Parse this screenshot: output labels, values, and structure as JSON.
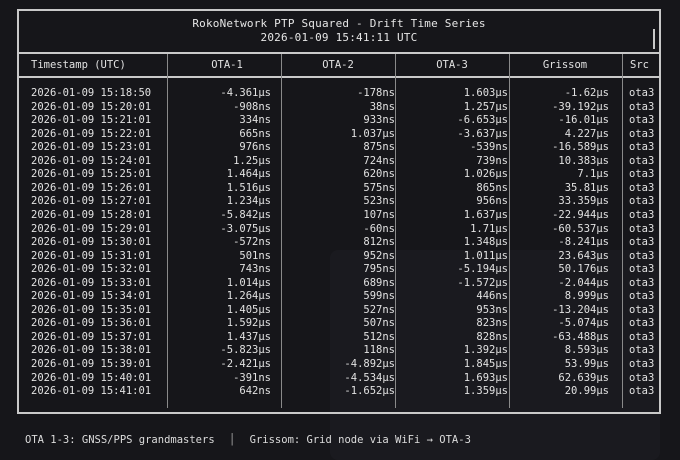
{
  "header": {
    "title": "RokoNetwork PTP Squared - Drift Time Series",
    "timestamp": "2026-01-09 15:41:11 UTC"
  },
  "columns": [
    "Timestamp (UTC)",
    "OTA-1",
    "OTA-2",
    "OTA-3",
    "Grissom",
    "Src"
  ],
  "rows": [
    [
      "2026-01-09 15:18:50",
      "-4.361µs",
      "-178ns",
      "1.603µs",
      "-1.62µs",
      "ota3"
    ],
    [
      "2026-01-09 15:20:01",
      "-908ns",
      "38ns",
      "1.257µs",
      "-39.192µs",
      "ota3"
    ],
    [
      "2026-01-09 15:21:01",
      "334ns",
      "933ns",
      "-6.653µs",
      "-16.01µs",
      "ota3"
    ],
    [
      "2026-01-09 15:22:01",
      "665ns",
      "1.037µs",
      "-3.637µs",
      "4.227µs",
      "ota3"
    ],
    [
      "2026-01-09 15:23:01",
      "976ns",
      "875ns",
      "-539ns",
      "-16.589µs",
      "ota3"
    ],
    [
      "2026-01-09 15:24:01",
      "1.25µs",
      "724ns",
      "739ns",
      "10.383µs",
      "ota3"
    ],
    [
      "2026-01-09 15:25:01",
      "1.464µs",
      "620ns",
      "1.026µs",
      "7.1µs",
      "ota3"
    ],
    [
      "2026-01-09 15:26:01",
      "1.516µs",
      "575ns",
      "865ns",
      "35.81µs",
      "ota3"
    ],
    [
      "2026-01-09 15:27:01",
      "1.234µs",
      "523ns",
      "956ns",
      "33.359µs",
      "ota3"
    ],
    [
      "2026-01-09 15:28:01",
      "-5.842µs",
      "107ns",
      "1.637µs",
      "-22.944µs",
      "ota3"
    ],
    [
      "2026-01-09 15:29:01",
      "-3.075µs",
      "-60ns",
      "1.71µs",
      "-60.537µs",
      "ota3"
    ],
    [
      "2026-01-09 15:30:01",
      "-572ns",
      "812ns",
      "1.348µs",
      "-8.241µs",
      "ota3"
    ],
    [
      "2026-01-09 15:31:01",
      "501ns",
      "952ns",
      "1.011µs",
      "23.643µs",
      "ota3"
    ],
    [
      "2026-01-09 15:32:01",
      "743ns",
      "795ns",
      "-5.194µs",
      "50.176µs",
      "ota3"
    ],
    [
      "2026-01-09 15:33:01",
      "1.014µs",
      "689ns",
      "-1.572µs",
      "-2.044µs",
      "ota3"
    ],
    [
      "2026-01-09 15:34:01",
      "1.264µs",
      "599ns",
      "446ns",
      "8.999µs",
      "ota3"
    ],
    [
      "2026-01-09 15:35:01",
      "1.405µs",
      "527ns",
      "953ns",
      "-13.204µs",
      "ota3"
    ],
    [
      "2026-01-09 15:36:01",
      "1.592µs",
      "507ns",
      "823ns",
      "-5.074µs",
      "ota3"
    ],
    [
      "2026-01-09 15:37:01",
      "1.437µs",
      "512ns",
      "828ns",
      "-63.488µs",
      "ota3"
    ],
    [
      "2026-01-09 15:38:01",
      "-5.823µs",
      "118ns",
      "1.392µs",
      "8.593µs",
      "ota3"
    ],
    [
      "2026-01-09 15:39:01",
      "-2.421µs",
      "-4.892µs",
      "1.845µs",
      "53.99µs",
      "ota3"
    ],
    [
      "2026-01-09 15:40:01",
      "-391ns",
      "-4.534µs",
      "1.693µs",
      "62.639µs",
      "ota3"
    ],
    [
      "2026-01-09 15:41:01",
      "642ns",
      "-1.652µs",
      "1.359µs",
      "20.99µs",
      "ota3"
    ]
  ],
  "footer": {
    "left": "OTA 1-3: GNSS/PPS grandmasters",
    "sep": "│",
    "right": "Grissom: Grid node via WiFi → OTA-3"
  }
}
